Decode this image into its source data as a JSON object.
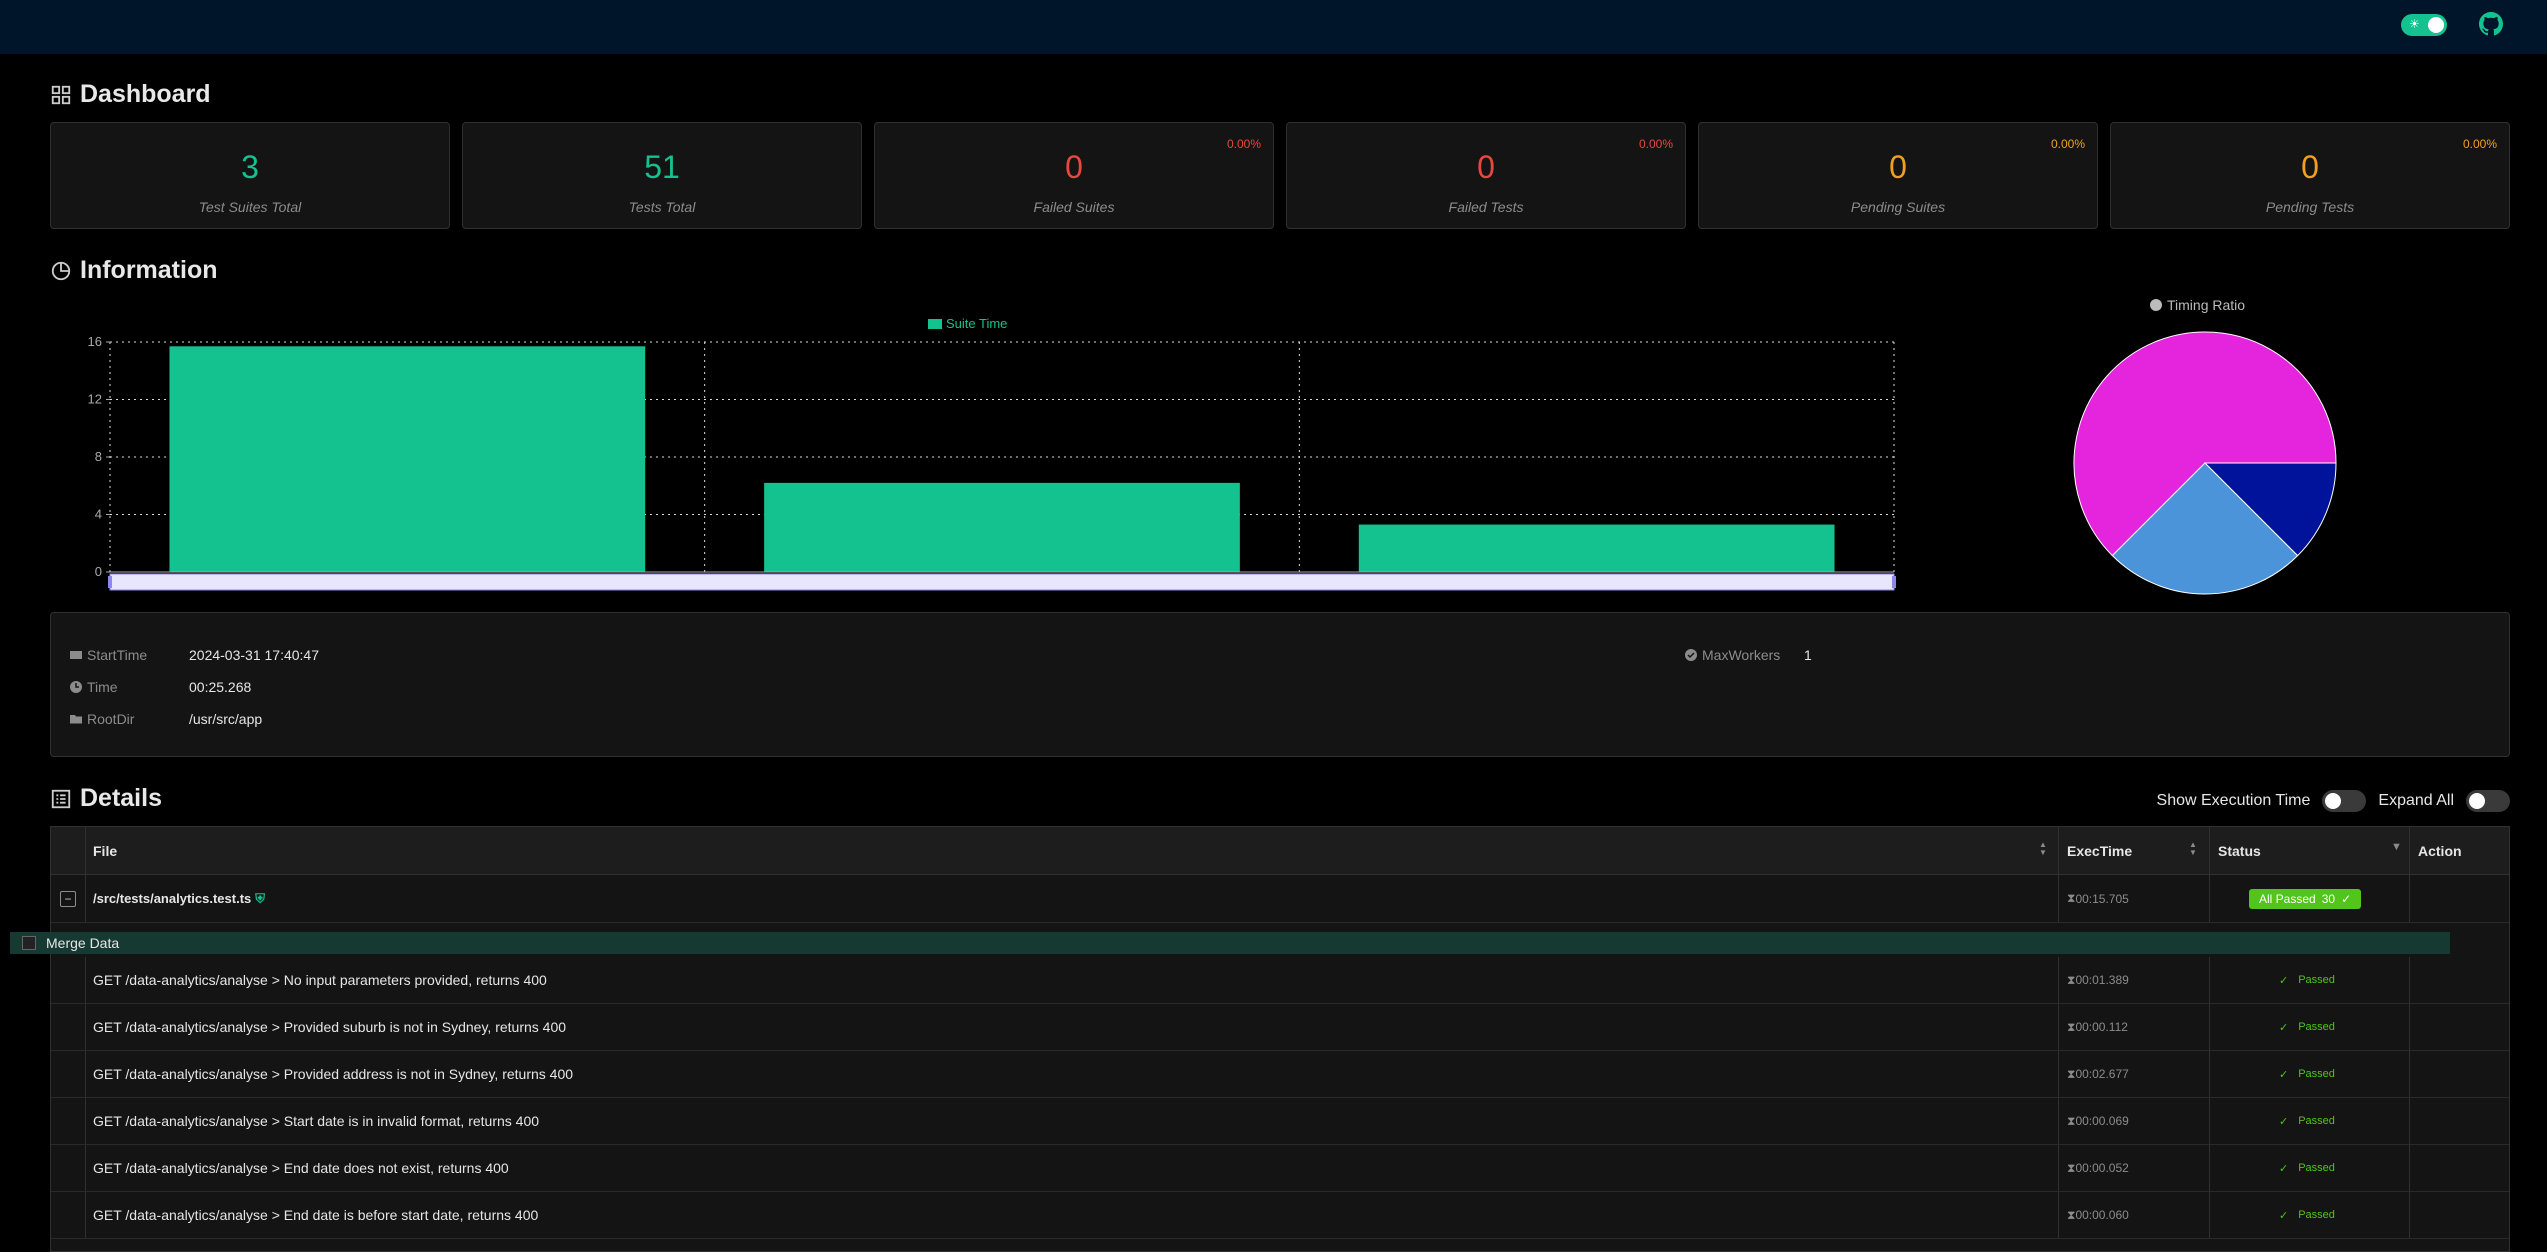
{
  "stats": [
    {
      "value": "3",
      "label": "Test Suites Total",
      "pct": ""
    },
    {
      "value": "51",
      "label": "Tests Total",
      "pct": ""
    },
    {
      "value": "0",
      "label": "Failed Suites",
      "pct": "0.00%"
    },
    {
      "value": "0",
      "label": "Failed Tests",
      "pct": "0.00%"
    },
    {
      "value": "0",
      "label": "Pending Suites",
      "pct": "0.00%"
    },
    {
      "value": "0",
      "label": "Pending Tests",
      "pct": "0.00%"
    }
  ],
  "sections": {
    "dashboard": "Dashboard",
    "information": "Information",
    "details": "Details"
  },
  "chart_data": [
    {
      "type": "bar",
      "legend": [
        "Suite Time"
      ],
      "categories": [
        "",
        "",
        ""
      ],
      "series": [
        {
          "name": "Suite Time",
          "values": [
            15.7,
            6.2,
            3.3
          ]
        }
      ],
      "yticks": [
        "0",
        "4",
        "8",
        "12",
        "16"
      ],
      "ylim": [
        0,
        16
      ],
      "grid": true,
      "color": "#13c28e"
    },
    {
      "type": "pie",
      "title": "Timing Ratio",
      "values": [
        62.5,
        25,
        12.5
      ],
      "colors": [
        "#e524de",
        "#4c94da",
        "#02139b"
      ]
    }
  ],
  "info": {
    "start_key": "StartTime",
    "start_val": "2024-03-31 17:40:47",
    "time_key": "Time",
    "time_val": "00:25.268",
    "root_key": "RootDir",
    "root_val": "/usr/src/app",
    "workers_key": "MaxWorkers",
    "workers_val": "1"
  },
  "controls": {
    "show_exec": "Show Execution Time",
    "expand_all": "Expand All"
  },
  "table": {
    "headers": {
      "file": "File",
      "exec": "ExecTime",
      "status": "Status",
      "action": "Action"
    },
    "suite": {
      "file": "/src/tests/analytics.test.ts",
      "exec": "00:15.705",
      "badge": "All Passed",
      "count": "30"
    },
    "group": "Merge Data",
    "rows": [
      {
        "name": "GET /data-analytics/analyse > No input parameters provided, returns 400",
        "exec": "00:01.389",
        "status": "Passed"
      },
      {
        "name": "GET /data-analytics/analyse > Provided suburb is not in Sydney, returns 400",
        "exec": "00:00.112",
        "status": "Passed"
      },
      {
        "name": "GET /data-analytics/analyse > Provided address is not in Sydney, returns 400",
        "exec": "00:02.677",
        "status": "Passed"
      },
      {
        "name": "GET /data-analytics/analyse > Start date is in invalid format, returns 400",
        "exec": "00:00.069",
        "status": "Passed"
      },
      {
        "name": "GET /data-analytics/analyse > End date does not exist, returns 400",
        "exec": "00:00.052",
        "status": "Passed"
      },
      {
        "name": "GET /data-analytics/analyse > End date is before start date, returns 400",
        "exec": "00:00.060",
        "status": "Passed"
      }
    ]
  }
}
